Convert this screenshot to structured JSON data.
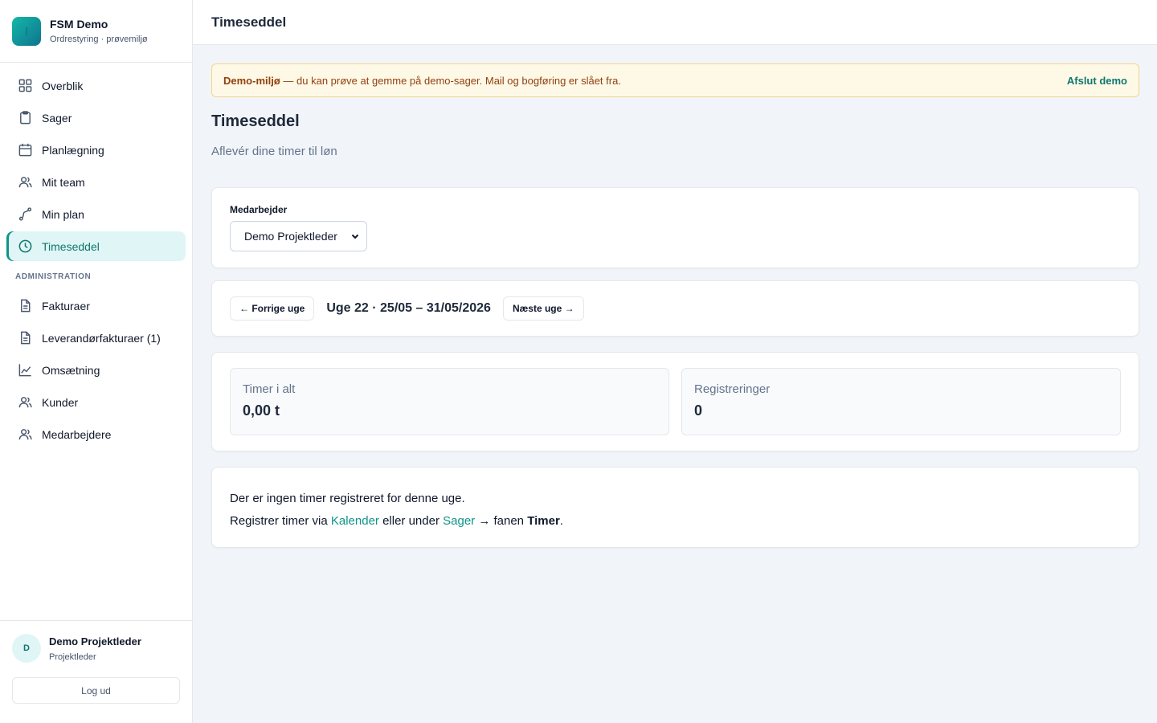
{
  "app": {
    "name": "FSM Demo",
    "subtitle": "Ordrestyring · prøvemiljø",
    "brand_color": "#0d9488"
  },
  "sidebar": {
    "items": [
      {
        "label": "Overblik",
        "icon": "grid-icon"
      },
      {
        "label": "Sager",
        "icon": "clipboard-icon"
      },
      {
        "label": "Planlægning",
        "icon": "calendar-icon"
      },
      {
        "label": "Mit team",
        "icon": "users-icon"
      },
      {
        "label": "Min plan",
        "icon": "route-icon"
      },
      {
        "label": "Timeseddel",
        "icon": "clock-icon",
        "active": true
      }
    ],
    "section_label": "ADMINISTRATION",
    "admin_items": [
      {
        "label": "Fakturaer",
        "icon": "document-icon"
      },
      {
        "label": "Leverandørfakturaer (1)",
        "icon": "document-icon"
      },
      {
        "label": "Omsætning",
        "icon": "line-chart-icon"
      },
      {
        "label": "Kunder",
        "icon": "users-icon"
      },
      {
        "label": "Medarbejdere",
        "icon": "users-icon"
      }
    ],
    "user": {
      "initial": "D",
      "name": "Demo Projektleder",
      "role": "Projektleder"
    },
    "logout_label": "Log ud"
  },
  "header": {
    "title": "Timeseddel"
  },
  "banner": {
    "strong": "Demo-miljø",
    "text": " — du kan prøve at gemme på demo-sager. Mail og bogføring er slået fra.",
    "action": "Afslut demo"
  },
  "page": {
    "title": "Timeseddel",
    "subtitle": "Aflevér dine timer til løn"
  },
  "employee": {
    "label": "Medarbejder",
    "selected": "Demo Projektleder"
  },
  "week": {
    "prev_label": "← Forrige uge",
    "label": "Uge 22 · 25/05 – 31/05/2026",
    "next_label": "Næste uge →"
  },
  "stats": [
    {
      "label": "Timer i alt",
      "value": "0,00 t"
    },
    {
      "label": "Registreringer",
      "value": "0"
    }
  ],
  "empty": {
    "line1": "Der er ingen timer registreret for denne uge.",
    "line2_a": "Registrer timer via ",
    "link_calendar": "Kalender",
    "line2_b": " eller under ",
    "link_cases": "Sager",
    "line2_c": " → fanen ",
    "line2_strong": "Timer",
    "line2_d": "."
  }
}
